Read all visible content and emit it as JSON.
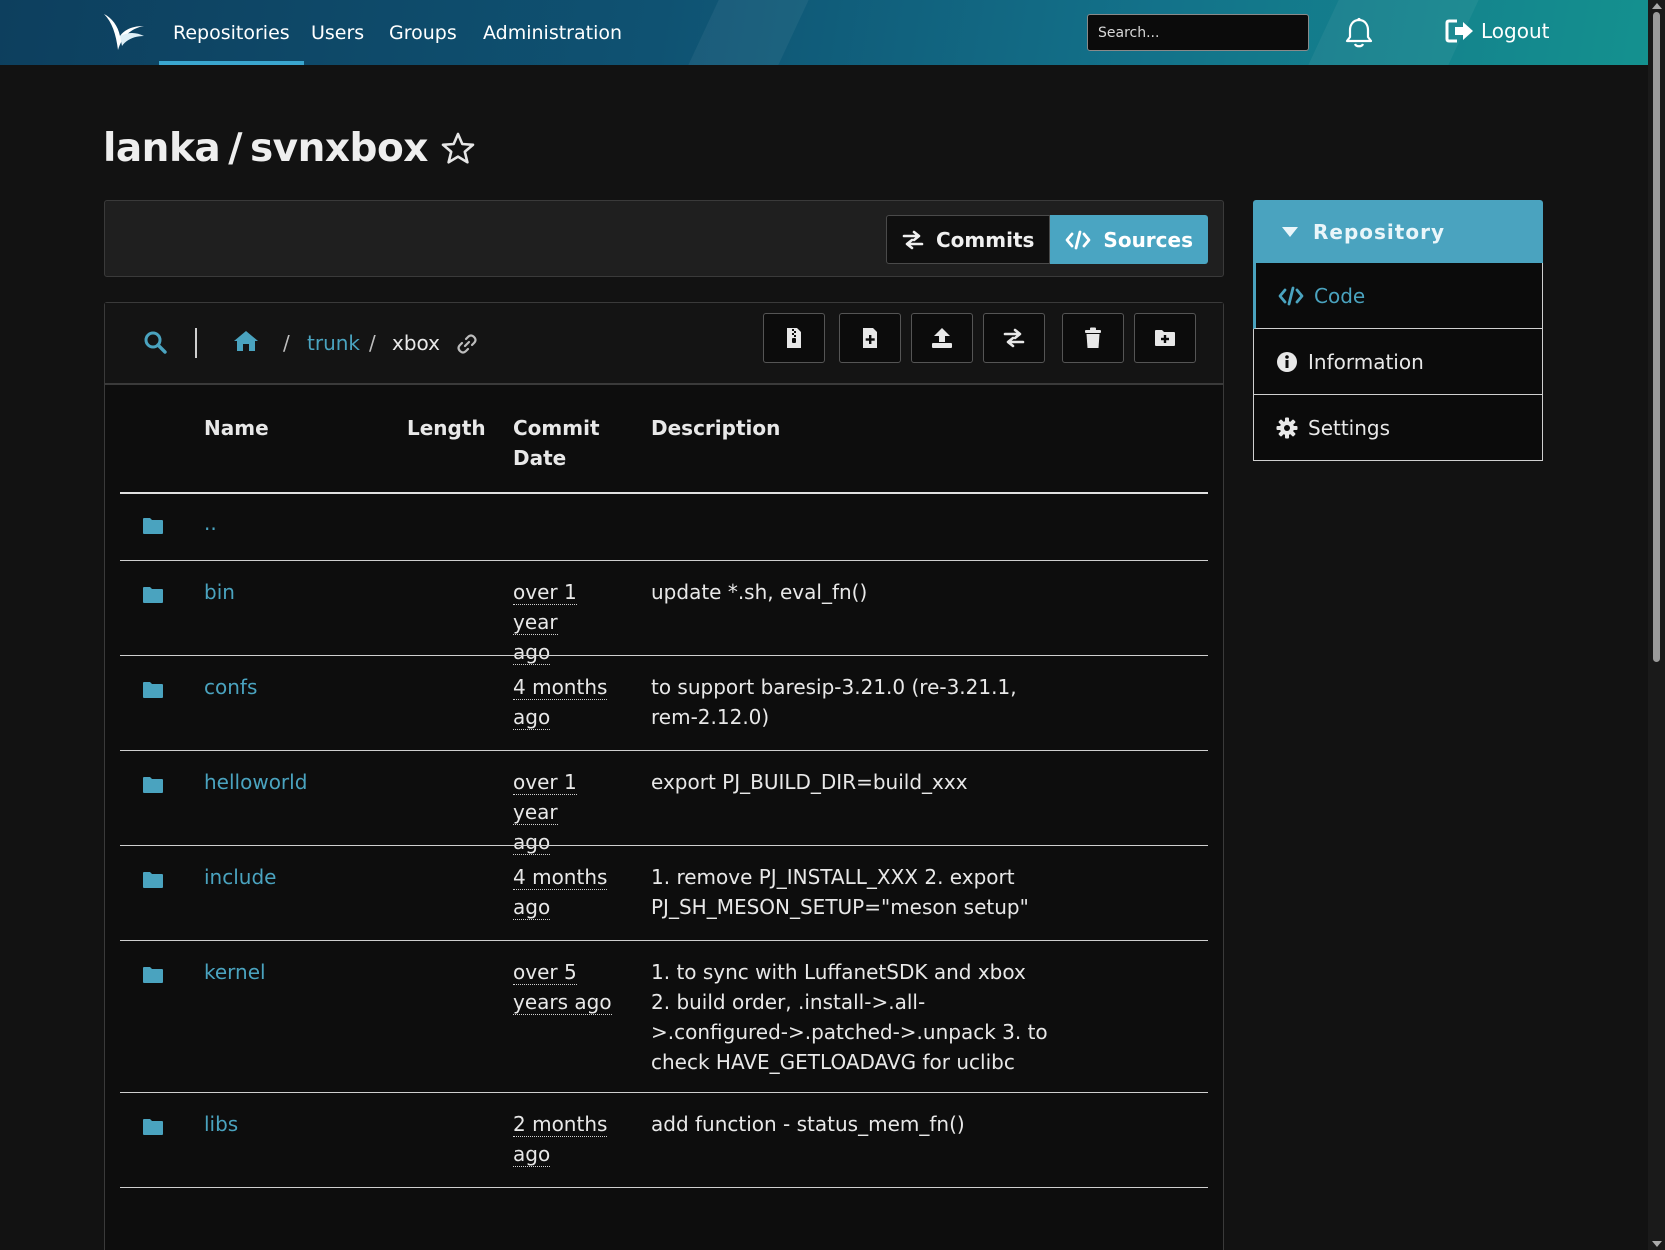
{
  "nav": {
    "items": [
      {
        "label": "Repositories",
        "active": true
      },
      {
        "label": "Users"
      },
      {
        "label": "Groups"
      },
      {
        "label": "Administration"
      }
    ],
    "search_placeholder": "Search...",
    "logout_label": "Logout"
  },
  "repo": {
    "namespace": "lanka",
    "separator": "/",
    "name": "svnxbox"
  },
  "toggle": {
    "commits_label": "Commits",
    "sources_label": "Sources",
    "active": "Sources"
  },
  "sidebar": {
    "header": "Repository",
    "items": [
      {
        "label": "Code",
        "icon": "code-icon",
        "active": true
      },
      {
        "label": "Information",
        "icon": "info-icon"
      },
      {
        "label": "Settings",
        "icon": "gear-icon"
      }
    ]
  },
  "breadcrumb": {
    "sep": "/",
    "branch": "trunk",
    "current": "xbox"
  },
  "table": {
    "headers": {
      "name": "Name",
      "length": "Length",
      "date_line1": "Commit",
      "date_line2": "Date",
      "description": "Description"
    },
    "rows": [
      {
        "name": "..",
        "length": "",
        "date_1": "",
        "date_2": "",
        "desc": ""
      },
      {
        "name": "bin",
        "length": "",
        "date_1": "over 1 year",
        "date_2": "ago",
        "desc": "update *.sh, eval_fn()"
      },
      {
        "name": "confs",
        "length": "",
        "date_1": "4 months",
        "date_2": "ago",
        "desc": "to support baresip-3.21.0 (re-3.21.1, rem-2.12.0)"
      },
      {
        "name": "helloworld",
        "length": "",
        "date_1": "over 1 year",
        "date_2": "ago",
        "desc": "export PJ_BUILD_DIR=build_xxx"
      },
      {
        "name": "include",
        "length": "",
        "date_1": "4 months",
        "date_2": "ago",
        "desc": "1. remove PJ_INSTALL_XXX 2. export PJ_SH_MESON_SETUP=\"meson setup\""
      },
      {
        "name": "kernel",
        "length": "",
        "date_1": "over 5",
        "date_2": "years ago",
        "desc": "1. to sync with LuffanetSDK and xbox 2. build order, .install->.all->.configured->.patched->.unpack 3. to check HAVE_GETLOADAVG for uclibc"
      },
      {
        "name": "libs",
        "length": "",
        "date_1": "2 months",
        "date_2": "ago",
        "desc": "add function - status_mem_fn()"
      }
    ]
  },
  "colors": {
    "accent": "#4aa3bf",
    "background": "#121212",
    "nav_start": "#0d3f5e",
    "nav_end": "#14918f"
  }
}
